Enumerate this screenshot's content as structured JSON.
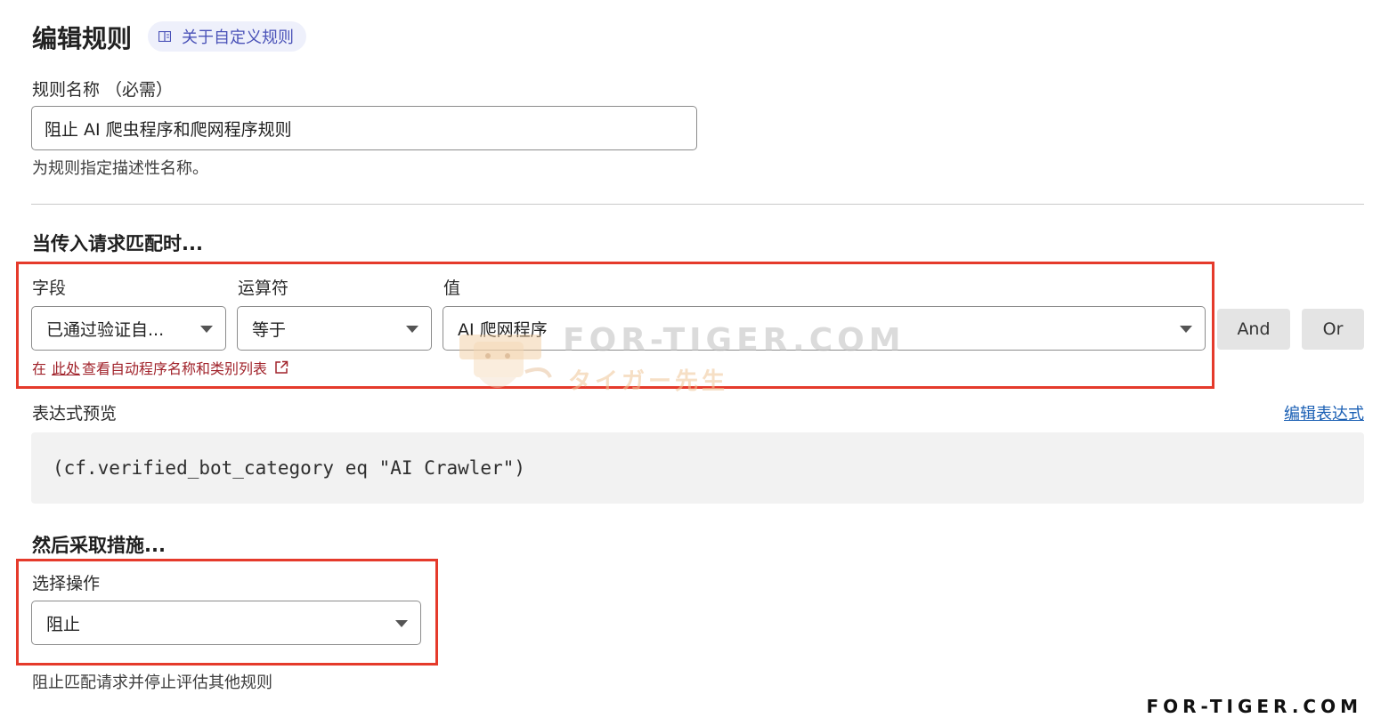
{
  "header": {
    "title": "编辑规则",
    "docs_link": "关于自定义规则"
  },
  "rule_name": {
    "label": "规则名称 （必需）",
    "value": "阻止 AI 爬虫程序和爬网程序规则",
    "helper": "为规则指定描述性名称。"
  },
  "match": {
    "heading": "当传入请求匹配时...",
    "field_label": "字段",
    "operator_label": "运算符",
    "value_label": "值",
    "field_value": "已通过验证自...",
    "operator_value": "等于",
    "value_value": "AI 爬网程序",
    "and_button": "And",
    "or_button": "Or",
    "hint_prefix": "在",
    "hint_link": "此处",
    "hint_suffix": "查看自动程序名称和类别列表"
  },
  "expression": {
    "label": "表达式预览",
    "edit_link": "编辑表达式",
    "value": "(cf.verified_bot_category eq \"AI Crawler\")"
  },
  "action": {
    "heading": "然后采取措施...",
    "label": "选择操作",
    "value": "阻止",
    "helper": "阻止匹配请求并停止评估其他规则"
  },
  "watermark": {
    "main": "FOR-TIGER.COM",
    "sub": "タイガー先生",
    "corner": "FOR-TIGER.COM"
  },
  "colors": {
    "highlight": "#e53a2b",
    "link": "#1a5fb4",
    "hint": "#a1232b",
    "pill_bg": "#eef0fb"
  },
  "icons": {
    "docs": "book-icon",
    "external": "external-link-icon",
    "dropdown": "caret-down-icon"
  }
}
